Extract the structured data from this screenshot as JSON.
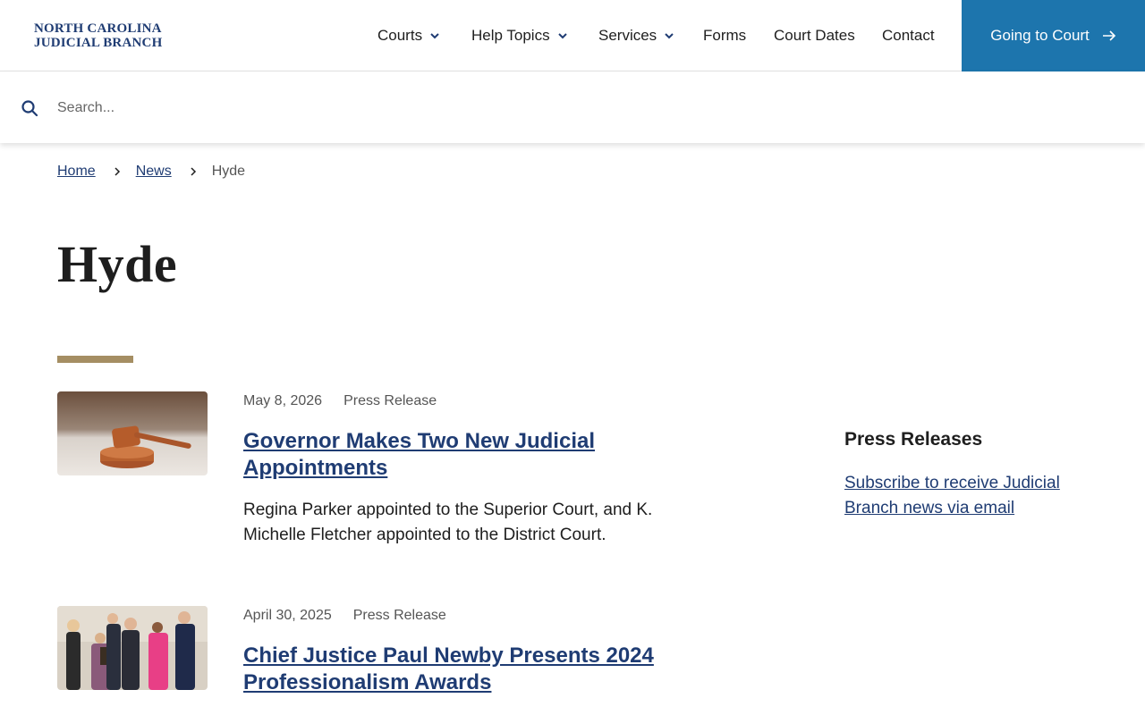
{
  "header": {
    "logo_line1": "NORTH CAROLINA",
    "logo_line2": "JUDICIAL BRANCH",
    "nav": {
      "courts": "Courts",
      "help_topics": "Help Topics",
      "services": "Services",
      "forms": "Forms",
      "court_dates": "Court Dates",
      "contact": "Contact"
    },
    "cta_label": "Going to Court"
  },
  "search": {
    "placeholder": "Search..."
  },
  "breadcrumb": {
    "home": "Home",
    "news": "News",
    "current": "Hyde"
  },
  "page": {
    "title": "Hyde"
  },
  "articles": [
    {
      "date": "May 8, 2026",
      "type": "Press Release",
      "headline": "Governor Makes Two New Judicial Appointments",
      "summary": "Regina Parker appointed to the Superior Court, and K. Michelle Fletcher appointed to the District Court."
    },
    {
      "date": "April 30, 2025",
      "type": "Press Release",
      "headline": "Chief Justice Paul Newby Presents 2024 Professionalism Awards"
    }
  ],
  "sidebar": {
    "title": "Press Releases",
    "subscribe_link": "Subscribe to receive Judicial Branch news via email"
  },
  "colors": {
    "brand_navy": "#1f3c73",
    "cta_blue": "#1d75ad",
    "accent_gold": "#a58e63"
  }
}
